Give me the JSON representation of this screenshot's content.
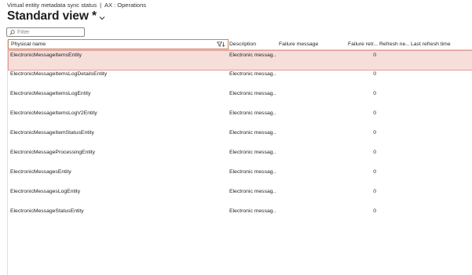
{
  "breadcrumb": {
    "page": "Virtual entity metadata sync status",
    "separator": "|",
    "module": "AX : Operations"
  },
  "view": {
    "title": "Standard view *"
  },
  "filter": {
    "placeholder": "Filter",
    "value": ""
  },
  "grid": {
    "columns": [
      "Physical name",
      "Description",
      "Failure message",
      "Failure retr...",
      "Refresh ne...",
      "Last refresh time"
    ],
    "rows": [
      {
        "physical_name": "ElectronicMessageItemsEntity",
        "description": "Electronic messag...",
        "failure_message": "",
        "failure_retries": "0",
        "refresh_needed": "",
        "last_refresh_time": ""
      },
      {
        "physical_name": "ElectronicMessageItemsLogDetailsEntity",
        "description": "Electronic messag...",
        "failure_message": "",
        "failure_retries": "0",
        "refresh_needed": "",
        "last_refresh_time": ""
      },
      {
        "physical_name": "ElectronicMessageItemsLogEntity",
        "description": "Electronic messag...",
        "failure_message": "",
        "failure_retries": "0",
        "refresh_needed": "",
        "last_refresh_time": ""
      },
      {
        "physical_name": "ElectronicMessageItemsLogV2Entity",
        "description": "Electronic messag...",
        "failure_message": "",
        "failure_retries": "0",
        "refresh_needed": "",
        "last_refresh_time": ""
      },
      {
        "physical_name": "ElectronicMessageItemStatusEntity",
        "description": "Electronic messag...",
        "failure_message": "",
        "failure_retries": "0",
        "refresh_needed": "",
        "last_refresh_time": ""
      },
      {
        "physical_name": "ElectronicMessageProcessingEntity",
        "description": "Electronic messag...",
        "failure_message": "",
        "failure_retries": "0",
        "refresh_needed": "",
        "last_refresh_time": ""
      },
      {
        "physical_name": "ElectronicMessagesEntity",
        "description": "Electronic messag...",
        "failure_message": "",
        "failure_retries": "0",
        "refresh_needed": "",
        "last_refresh_time": ""
      },
      {
        "physical_name": "ElectronicMessagesLogEntity",
        "description": "Electronic messag...",
        "failure_message": "",
        "failure_retries": "0",
        "refresh_needed": "",
        "last_refresh_time": ""
      },
      {
        "physical_name": "ElectronicMessageStatusEntity",
        "description": "Electronic messag...",
        "failure_message": "",
        "failure_retries": "0",
        "refresh_needed": "",
        "last_refresh_time": ""
      }
    ],
    "selected_row": 0
  },
  "icons": {
    "view_menu": "chevron-down-icon",
    "filter": "search-icon",
    "column_filter": "funnel-filter-icon"
  },
  "colors": {
    "selected_row_bg": "#f6dedb",
    "selected_row_border": "#e79b93",
    "active_header_border": "#c6865f"
  }
}
